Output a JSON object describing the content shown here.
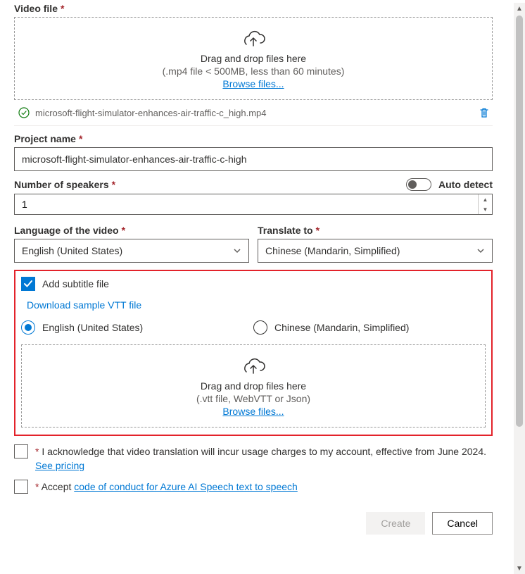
{
  "video_file": {
    "label": "Video file",
    "dz_line1": "Drag and drop files here",
    "dz_line2": "(.mp4 file < 500MB, less than 60 minutes)",
    "browse": "Browse files...",
    "uploaded_name": "microsoft-flight-simulator-enhances-air-traffic-c_high.mp4"
  },
  "project_name": {
    "label": "Project name",
    "value": "microsoft-flight-simulator-enhances-air-traffic-c-high"
  },
  "speakers": {
    "label": "Number of speakers",
    "auto_detect": "Auto detect",
    "value": "1"
  },
  "lang_source": {
    "label": "Language of the video",
    "value": "English (United States)"
  },
  "lang_target": {
    "label": "Translate to",
    "value": "Chinese (Mandarin, Simplified)"
  },
  "subtitle": {
    "checkbox_label": "Add subtitle file",
    "download_link": "Download sample VTT file",
    "radio_en": "English (United States)",
    "radio_zh": "Chinese (Mandarin, Simplified)",
    "dz_line1": "Drag and drop files here",
    "dz_line2": "(.vtt file, WebVTT or Json)",
    "browse": "Browse files..."
  },
  "ack1_prefix": "*",
  "ack1_text": " I acknowledge that video translation will incur usage charges to my account, effective from June 2024. ",
  "ack1_link": "See pricing",
  "ack2_prefix": "*",
  "ack2_text": " Accept ",
  "ack2_link": "code of conduct for Azure AI Speech text to speech",
  "buttons": {
    "create": "Create",
    "cancel": "Cancel"
  }
}
